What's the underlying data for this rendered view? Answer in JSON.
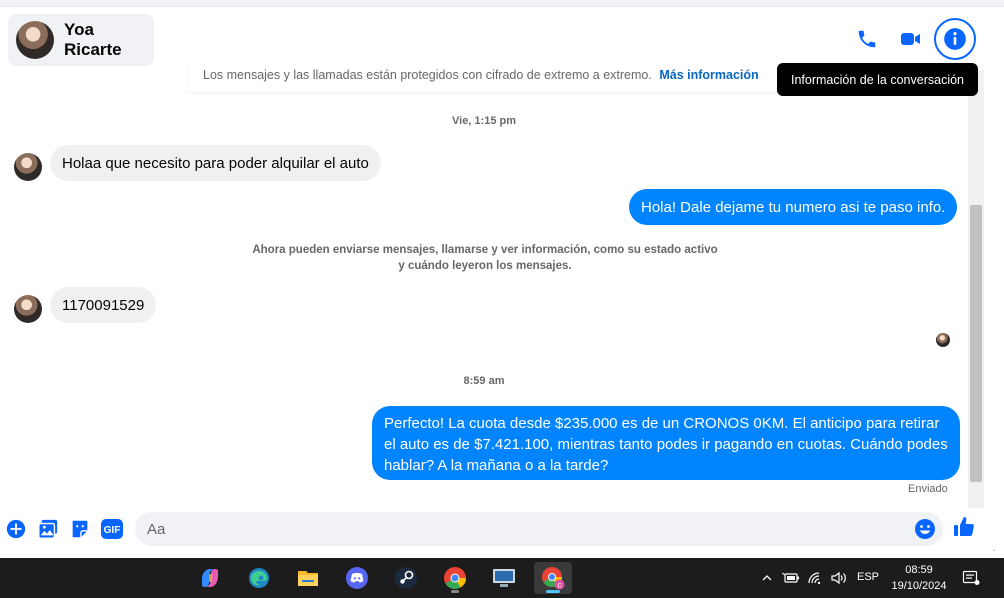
{
  "header": {
    "contact_name": "Yoa Ricarte",
    "icons": [
      "phone-icon",
      "video-call-icon",
      "info-icon"
    ]
  },
  "tooltip": "Información de la conversación",
  "banner": {
    "text": "Los mensajes y las llamadas están protegidos con cifrado de extremo a extremo.",
    "link": "Más información"
  },
  "conversation": {
    "timestamp_1": "Vie, 1:15 pm",
    "message_1": "Holaa que necesito para poder alquilar el auto",
    "message_2": "Hola! Dale dejame tu numero  asi te paso info.",
    "system_note": "Ahora pueden enviarse mensajes, llamarse y ver información, como su estado activo y cuándo leyeron los mensajes.",
    "message_3": "1170091529",
    "timestamp_2": "8:59 am",
    "message_4": "Perfecto! La cuota desde $235.000 es de un CRONOS 0KM. El anticipo para retirar el auto es de $7.421.100, mientras tanto podes ir pagando en cuotas. Cuándo podes hablar? A la mañana o a la tarde?",
    "status": "Enviado"
  },
  "composer": {
    "placeholder": "Aa",
    "value": "",
    "icons": [
      "plus-icon",
      "image-icon",
      "sticker-icon",
      "gif-icon",
      "emoji-icon",
      "like-icon"
    ],
    "gif_label": "GIF"
  },
  "taskbar": {
    "apps": [
      "copilot-icon",
      "edge-icon",
      "file-explorer-icon",
      "discord-icon",
      "steam-icon",
      "chrome-icon",
      "remote-desktop-icon",
      "chrome-profile-icon"
    ],
    "language": "ESP",
    "time": "08:59",
    "date": "19/10/2024"
  },
  "colors": {
    "accent": "#0084ff",
    "brand_blue": "#0866ff",
    "incoming_bubble": "#f0f0f0",
    "taskbar": "#1c1c1c"
  }
}
